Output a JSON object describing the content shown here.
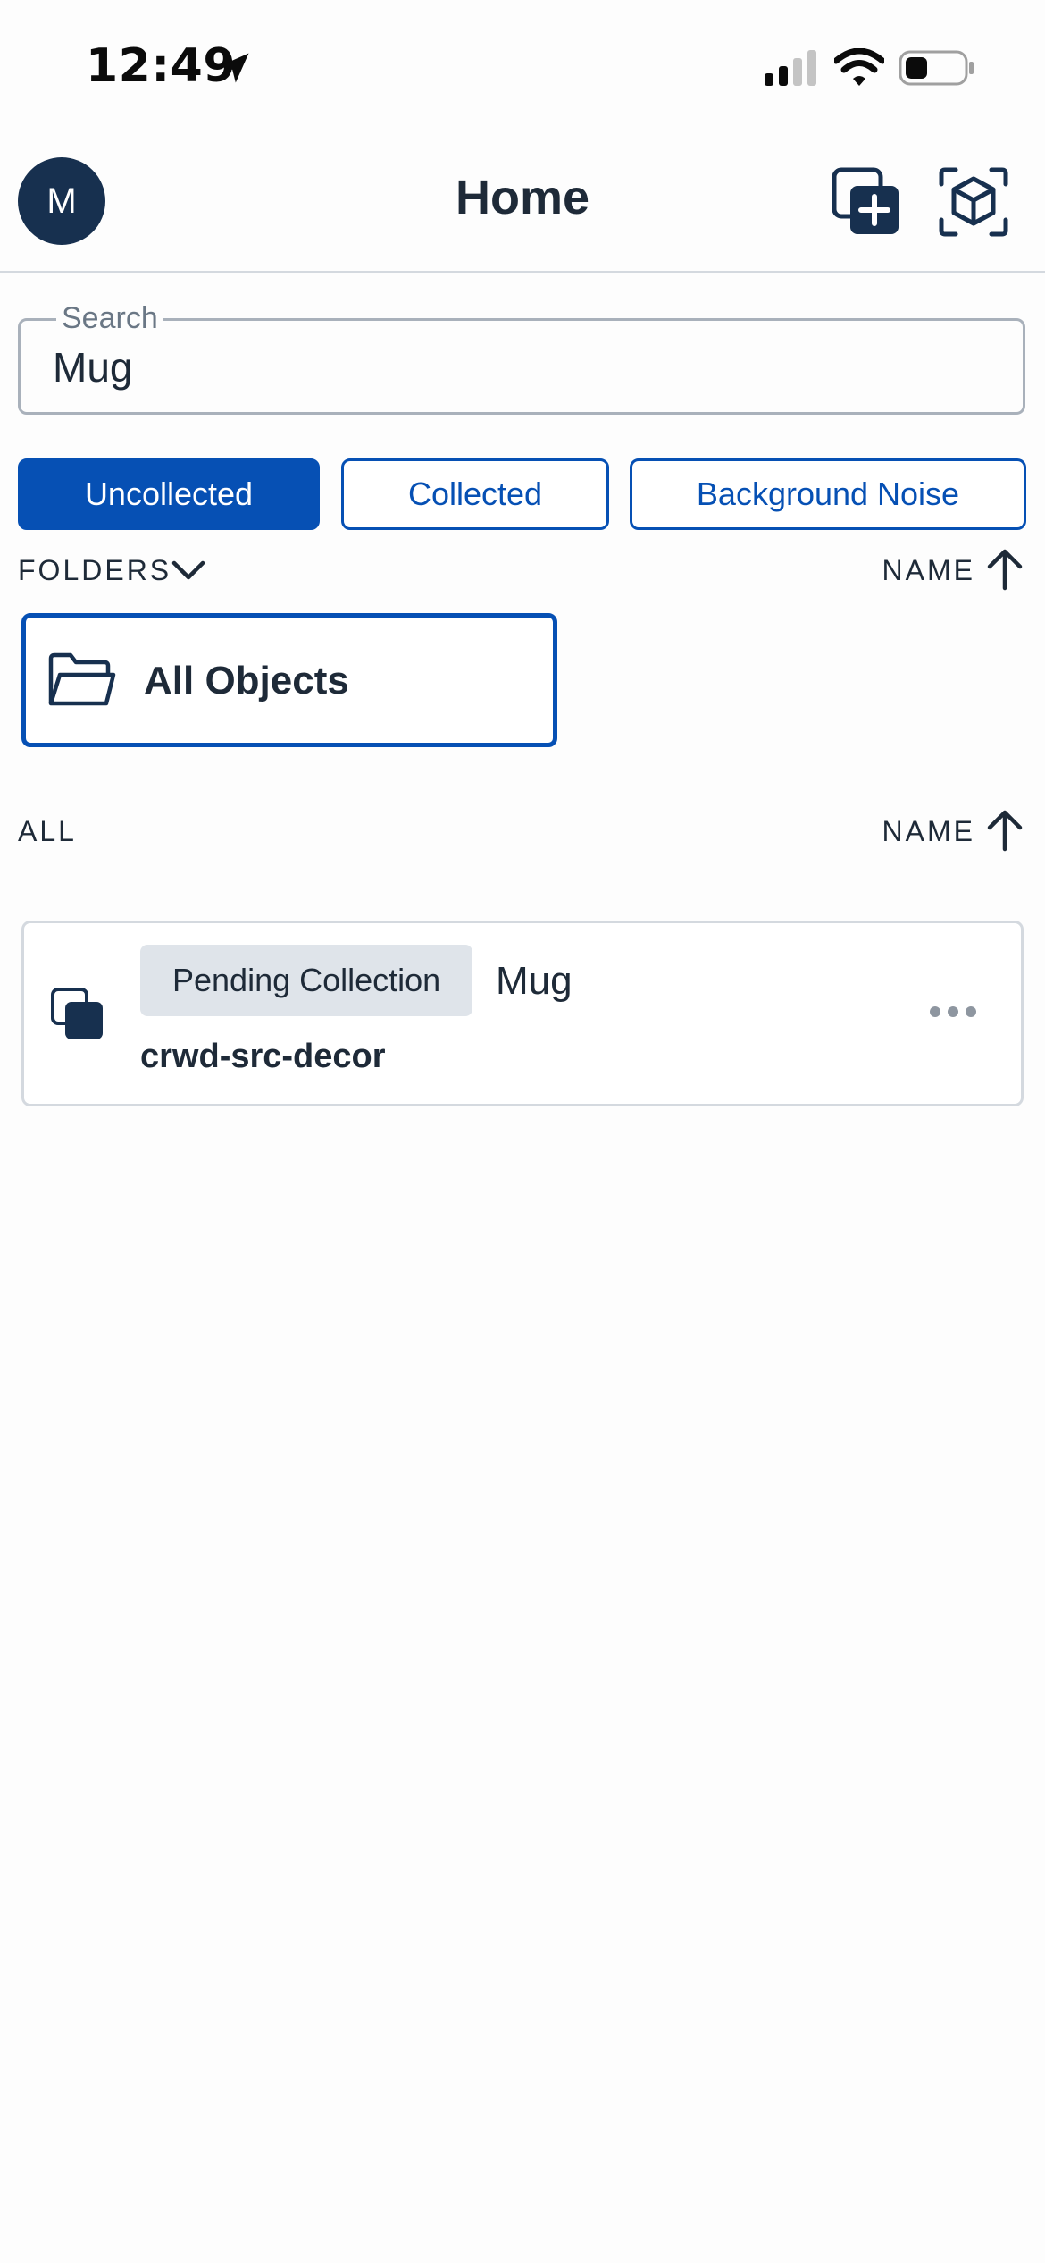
{
  "status_bar": {
    "time": "12:49",
    "icons": [
      "location-arrow-icon",
      "cellular-signal-icon",
      "wifi-icon",
      "battery-icon"
    ]
  },
  "header": {
    "avatar_initial": "M",
    "title": "Home",
    "actions": [
      "add-object-icon",
      "scan-cube-icon"
    ]
  },
  "search": {
    "label": "Search",
    "value": "Mug"
  },
  "filter_tabs": [
    {
      "label": "Uncollected",
      "active": true
    },
    {
      "label": "Collected",
      "active": false
    },
    {
      "label": "Background Noise",
      "active": false
    }
  ],
  "folders_section": {
    "label": "FOLDERS",
    "sort_label": "NAME",
    "sort_direction": "ascending"
  },
  "folders": [
    {
      "label": "All Objects",
      "selected": true
    }
  ],
  "all_section": {
    "label": "ALL",
    "sort_label": "NAME",
    "sort_direction": "ascending"
  },
  "objects": [
    {
      "status": "Pending Collection",
      "name": "Mug",
      "folder": "crwd-src-decor"
    }
  ],
  "colors": {
    "accent": "#0650b4",
    "avatar_bg": "#17304f",
    "text": "#1e2a38",
    "badge_bg": "#dfe4ea",
    "border": "#d4d9df"
  }
}
